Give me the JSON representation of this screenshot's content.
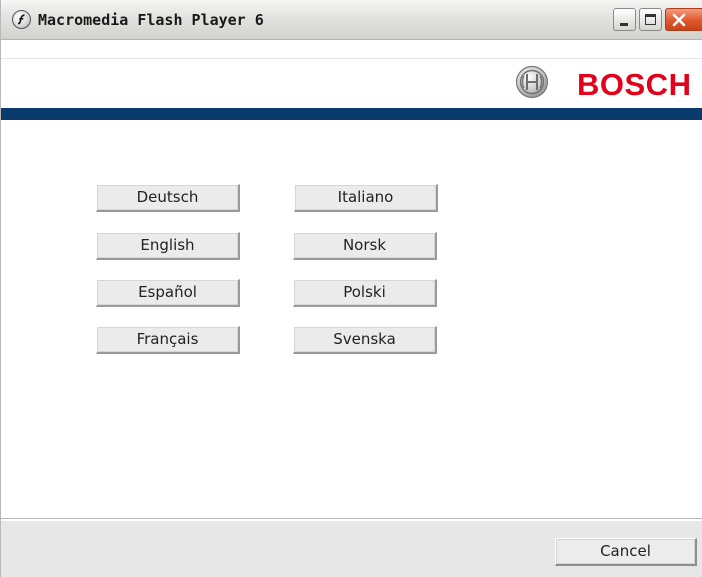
{
  "window": {
    "title": "Macromedia Flash Player 6"
  },
  "header": {
    "brand": "BOSCH",
    "brand_color": "#e2001a",
    "bar_color": "#0b3a6c"
  },
  "languages": {
    "left": [
      "Deutsch",
      "English",
      "Español",
      "Français"
    ],
    "right": [
      "Italiano",
      "Norsk",
      "Polski",
      "Svenska"
    ]
  },
  "footer": {
    "cancel_label": "Cancel"
  },
  "icons": {
    "app": "flash-player-icon",
    "minimize": "minimize-icon",
    "maximize": "maximize-icon",
    "close": "close-icon",
    "logo": "bosch-armature-logo"
  }
}
